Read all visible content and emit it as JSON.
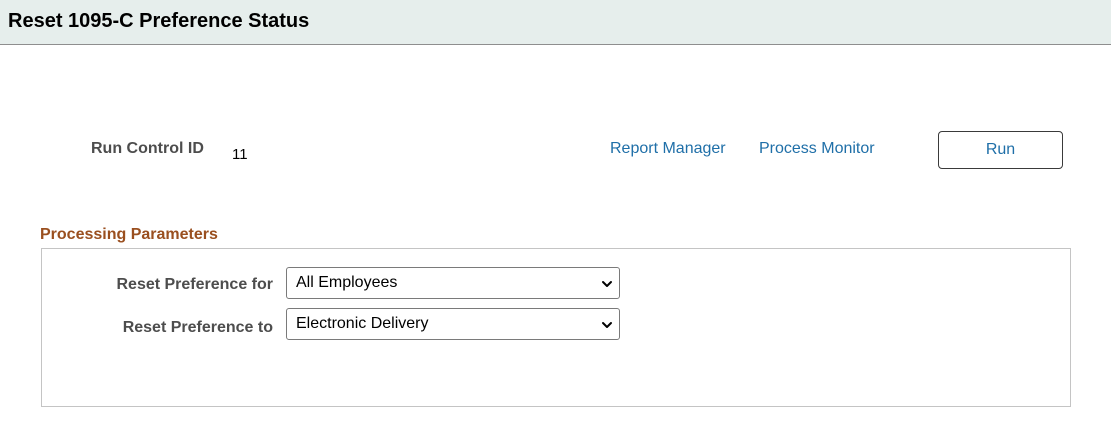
{
  "header": {
    "title": "Reset 1095-C Preference Status"
  },
  "run_control": {
    "label": "Run Control ID",
    "value": "11"
  },
  "links": {
    "report_manager": "Report Manager",
    "process_monitor": "Process Monitor"
  },
  "actions": {
    "run_label": "Run"
  },
  "processing_parameters": {
    "title": "Processing Parameters",
    "reset_for": {
      "label": "Reset Preference for",
      "selected": "All Employees"
    },
    "reset_to": {
      "label": "Reset Preference to",
      "selected": "Electronic Delivery"
    }
  },
  "colors": {
    "header_bg": "#e6eeec",
    "link": "#1f6fa8",
    "section_title": "#9a4f1f",
    "label": "#4d4d4d"
  },
  "icons": {
    "dropdown": "chevron-down-icon"
  }
}
